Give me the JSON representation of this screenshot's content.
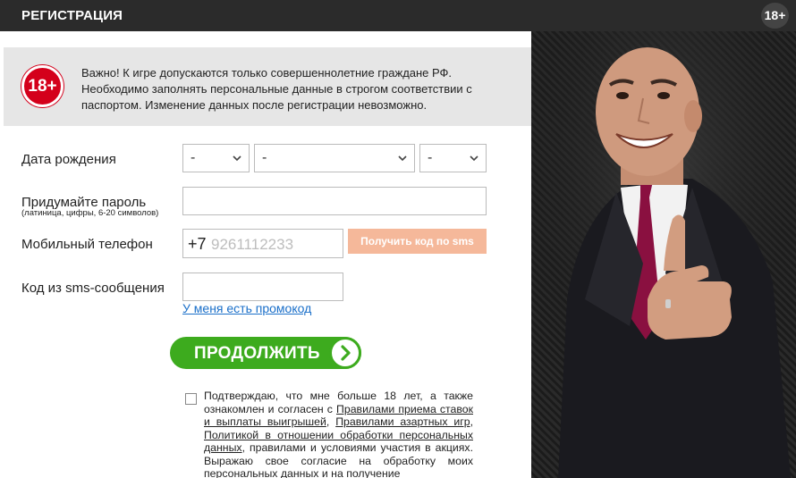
{
  "header": {
    "title": "РЕГИСТРАЦИЯ",
    "age_badge": "18+"
  },
  "notice": {
    "badge": "18+",
    "line1": "Важно! К игре допускаются только совершеннолетние граждане РФ.",
    "line2": "Необходимо заполнять персональные данные в строгом соответствии с",
    "line3": "паспортом. Изменение данных после регистрации невозможно."
  },
  "form": {
    "dob_label": "Дата рождения",
    "dob_day": "-",
    "dob_month": "-",
    "dob_year": "-",
    "password_label": "Придумайте пароль",
    "password_hint": "(латиница, цифры, 6-20 символов)",
    "phone_label": "Мобильный телефон",
    "phone_prefix": "+7",
    "phone_placeholder": "9261112233",
    "sms_button": "Получить код по sms",
    "sms_code_label": "Код из sms-сообщения",
    "promo_link": "У меня есть промокод",
    "continue_button": "ПРОДОЛЖИТЬ"
  },
  "consent": {
    "text1": "Подтверждаю, что мне больше 18 лет, а также ознакомлен и согласен с ",
    "link1": "Правилами приема ставок и выплаты выигрышей",
    "text2": ", ",
    "link2": "Правилами азартных игр",
    "text3": ", ",
    "link3": "Политикой в отношении обработки персональных данных",
    "text4": ", правилами и условиями участия в акциях. Выражаю свое согласие на обработку моих персональных данных и на получение"
  },
  "icons": {
    "chevron": "chevron-down-icon",
    "arrow": "arrow-right-icon",
    "checkbox": "checkbox-icon"
  },
  "colors": {
    "header_bg": "#2b2b2b",
    "badge_red": "#d4001b",
    "continue_green": "#3dab1e",
    "sms_button": "#f5b89a",
    "link_blue": "#1a6fc9"
  }
}
